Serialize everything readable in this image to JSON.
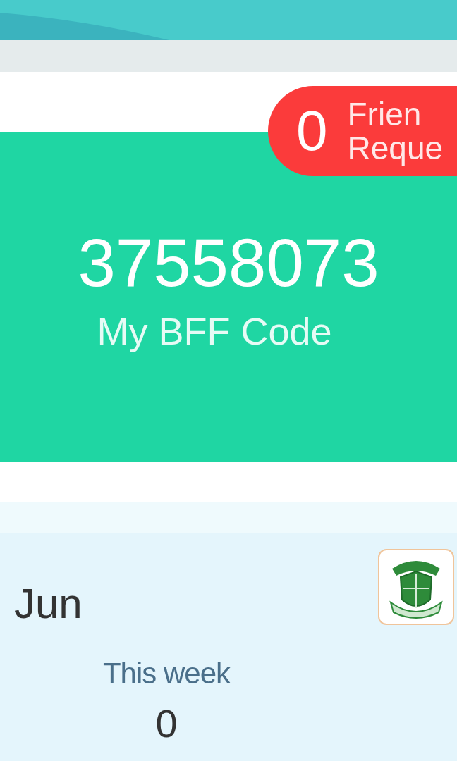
{
  "friend_requests": {
    "count": "0",
    "label_lines": [
      "Frien",
      "Reque"
    ]
  },
  "bff": {
    "code": "37558073",
    "label": "My BFF Code"
  },
  "summary": {
    "month": "Jun",
    "stats": [
      {
        "label": "This week",
        "value": "0"
      }
    ]
  }
}
